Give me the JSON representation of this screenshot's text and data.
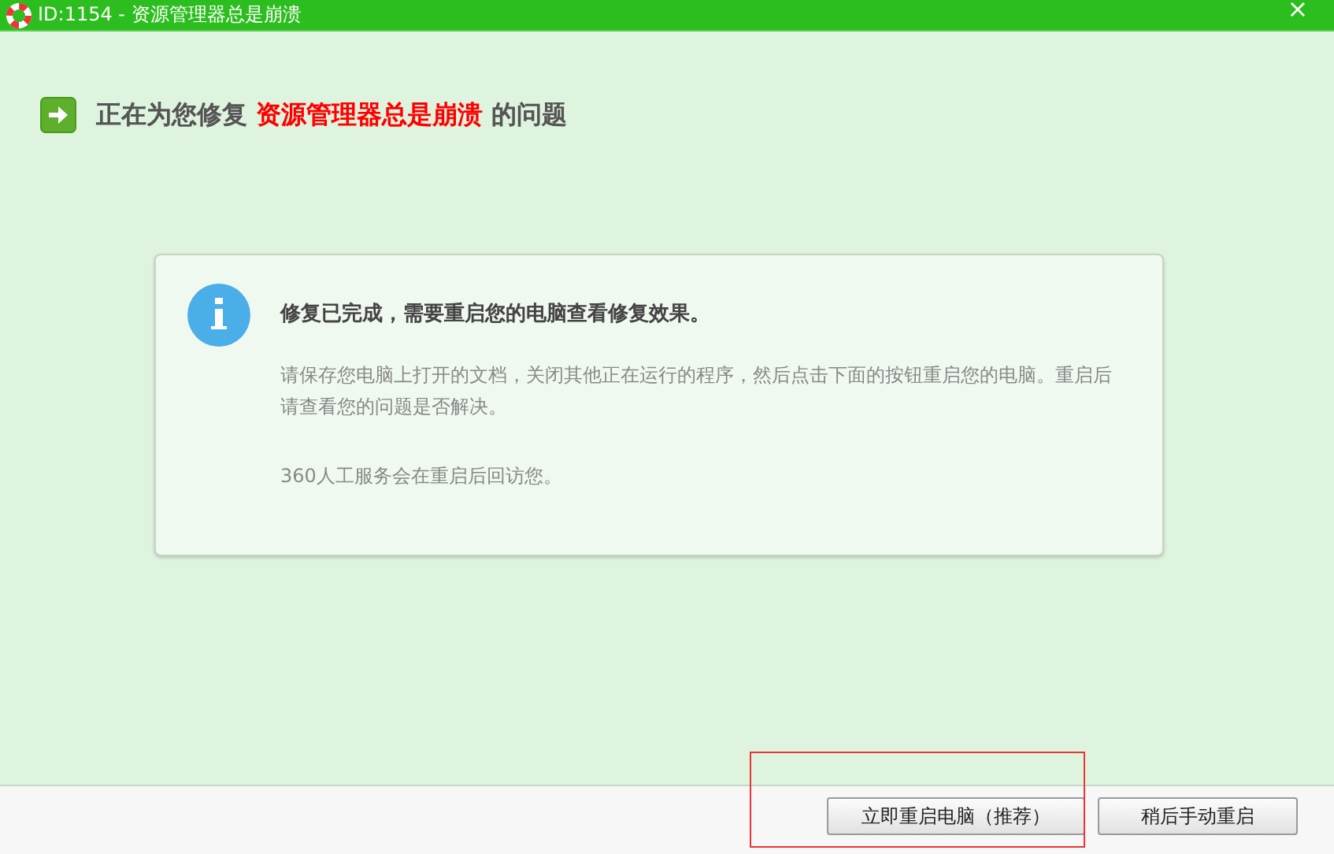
{
  "window": {
    "title": "ID:1154 - 资源管理器总是崩溃",
    "close": "×"
  },
  "header": {
    "before": "正在为您修复",
    "highlight": "资源管理器总是崩溃",
    "after": "的问题"
  },
  "card": {
    "title": "修复已完成，需要重启您的电脑查看修复效果。",
    "paragraphs": [
      "请保存您电脑上打开的文档，关闭其他正在运行的程序，然后点击下面的按钮重启您的电脑。重启后请查看您的问题是否解决。",
      "360人工服务会在重启后回访您。"
    ]
  },
  "buttons": [
    {
      "label": "立即重启电脑（推荐）",
      "annotated": true
    },
    {
      "label": "稍后手动重启",
      "annotated": false
    }
  ]
}
